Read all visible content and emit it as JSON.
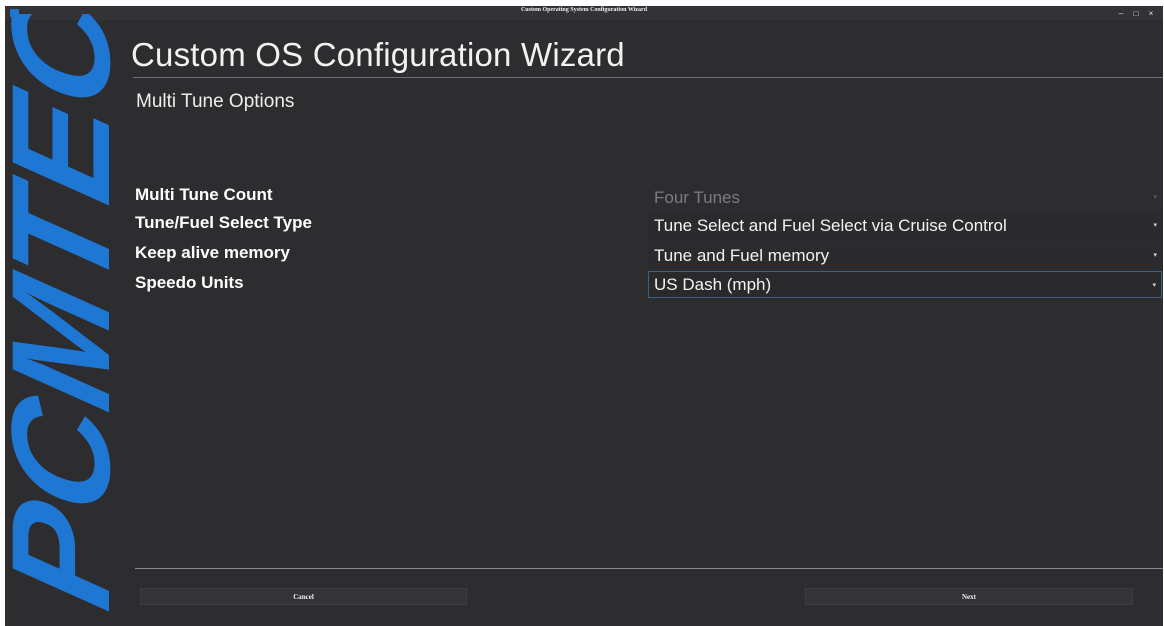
{
  "window": {
    "title": "Custom Operating System Configuration Wizard",
    "controls": {
      "minimize": "–",
      "maximize": "□",
      "close": "×"
    }
  },
  "brand": {
    "logo_text": "PCMTEC",
    "color": "#1f77d4"
  },
  "wizard": {
    "title": "Custom OS Configuration Wizard",
    "subtitle": "Multi Tune Options"
  },
  "options": [
    {
      "label": "Multi Tune Count",
      "value": "Four Tunes",
      "disabled": true
    },
    {
      "label": "Tune/Fuel Select Type",
      "value": "Tune Select and Fuel Select via Cruise Control"
    },
    {
      "label": "Keep alive memory",
      "value": "Tune and Fuel memory"
    },
    {
      "label": "Speedo Units",
      "value": "US Dash (mph)",
      "focused": true
    }
  ],
  "buttons": {
    "cancel": "Cancel",
    "next": "Next"
  },
  "icons": {
    "dropdown": "▾"
  }
}
